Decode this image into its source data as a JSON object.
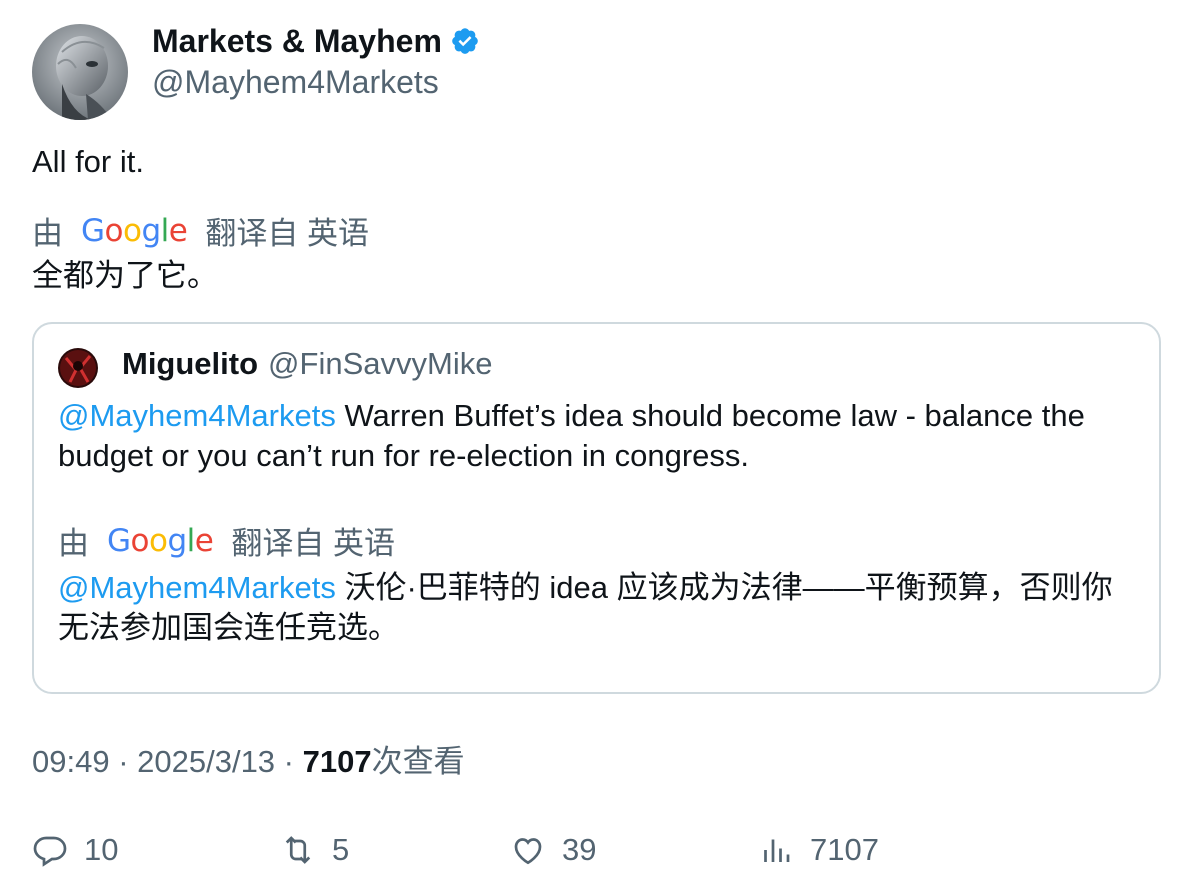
{
  "author": {
    "name": "Markets & Mayhem",
    "handle": "@Mayhem4Markets",
    "avatar_icon": "robot-avatar"
  },
  "tweet": {
    "text": "All for it.",
    "translation_prefix": "由",
    "translation_brand": "Google",
    "translation_suffix": "翻译自 英语",
    "translated_text": "全都为了它。"
  },
  "quote": {
    "name": "Miguelito",
    "handle": "@FinSavvyMike",
    "mention": "@Mayhem4Markets",
    "text": " Warren Buffet’s idea should become law - balance the budget or you can’t run for re-election in congress.",
    "translation_prefix": "由",
    "translation_brand": "Google",
    "translation_suffix": "翻译自 英语",
    "translated_mention": "@Mayhem4Markets",
    "translated_text": " 沃伦·巴菲特的 idea 应该成为法律——平衡预算，否则你无法参加国会连任竞选。"
  },
  "meta": {
    "time": "09:49",
    "separator1": " · ",
    "date": "2025/3/13",
    "separator2": " · ",
    "views_count": "7107",
    "views_label": "次查看"
  },
  "actions": {
    "replies": "10",
    "reposts": "5",
    "likes": "39",
    "views": "7107"
  },
  "colors": {
    "accent": "#1d9bf0",
    "secondary_text": "#536471",
    "border": "#cfd9de"
  }
}
